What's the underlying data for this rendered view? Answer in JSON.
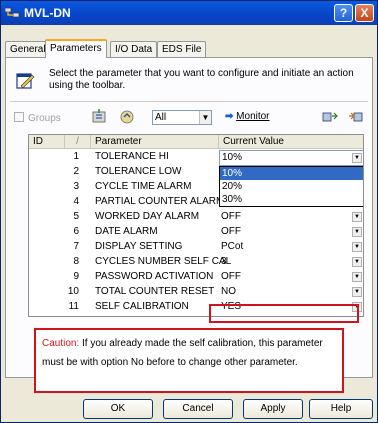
{
  "window": {
    "title": "MVL-DN",
    "help_glyph": "?",
    "close_glyph": "X"
  },
  "tabs": [
    {
      "label": "General",
      "active": false
    },
    {
      "label": "Parameters",
      "active": true
    },
    {
      "label": "I/O Data",
      "active": false
    },
    {
      "label": "EDS File",
      "active": false
    }
  ],
  "description": "Select the parameter that you want to configure and initiate an action using the toolbar.",
  "toolbar": {
    "groups_label": "Groups",
    "filter_value": "All",
    "monitor_label": "Monitor"
  },
  "grid": {
    "headers": {
      "id": "ID",
      "sort": "/",
      "parameter": "Parameter",
      "value": "Current Value"
    },
    "rows": [
      {
        "id": "1",
        "parameter": "TOLERANCE HI",
        "value": "10%"
      },
      {
        "id": "2",
        "parameter": "TOLERANCE LOW",
        "value": ""
      },
      {
        "id": "3",
        "parameter": "CYCLE TIME ALARM",
        "value": ""
      },
      {
        "id": "4",
        "parameter": "PARTIAL COUNTER ALARM",
        "value": ""
      },
      {
        "id": "5",
        "parameter": "WORKED DAY ALARM",
        "value": "OFF"
      },
      {
        "id": "6",
        "parameter": "DATE ALARM",
        "value": "OFF"
      },
      {
        "id": "7",
        "parameter": "DISPLAY SETTING",
        "value": "PCot"
      },
      {
        "id": "8",
        "parameter": "CYCLES NUMBER SELF CAL",
        "value": "3"
      },
      {
        "id": "9",
        "parameter": "PASSWORD ACTIVATION",
        "value": "OFF"
      },
      {
        "id": "10",
        "parameter": "TOTAL COUNTER RESET",
        "value": "NO"
      },
      {
        "id": "11",
        "parameter": "SELF CALIBRATION",
        "value": "YES"
      }
    ],
    "dropdown_options": [
      "10%",
      "20%",
      "30%"
    ],
    "dropdown_selected": "10%"
  },
  "caution": {
    "label": "Caution:",
    "text": "If you already made the self calibration, this parameter must be with option No before to change other parameter."
  },
  "buttons": {
    "ok": "OK",
    "cancel": "Cancel",
    "apply": "Apply",
    "help": "Help"
  },
  "colors": {
    "accent_red": "#d0141e",
    "selection_blue": "#316ac5",
    "title_blue": "#0a5ae0"
  }
}
